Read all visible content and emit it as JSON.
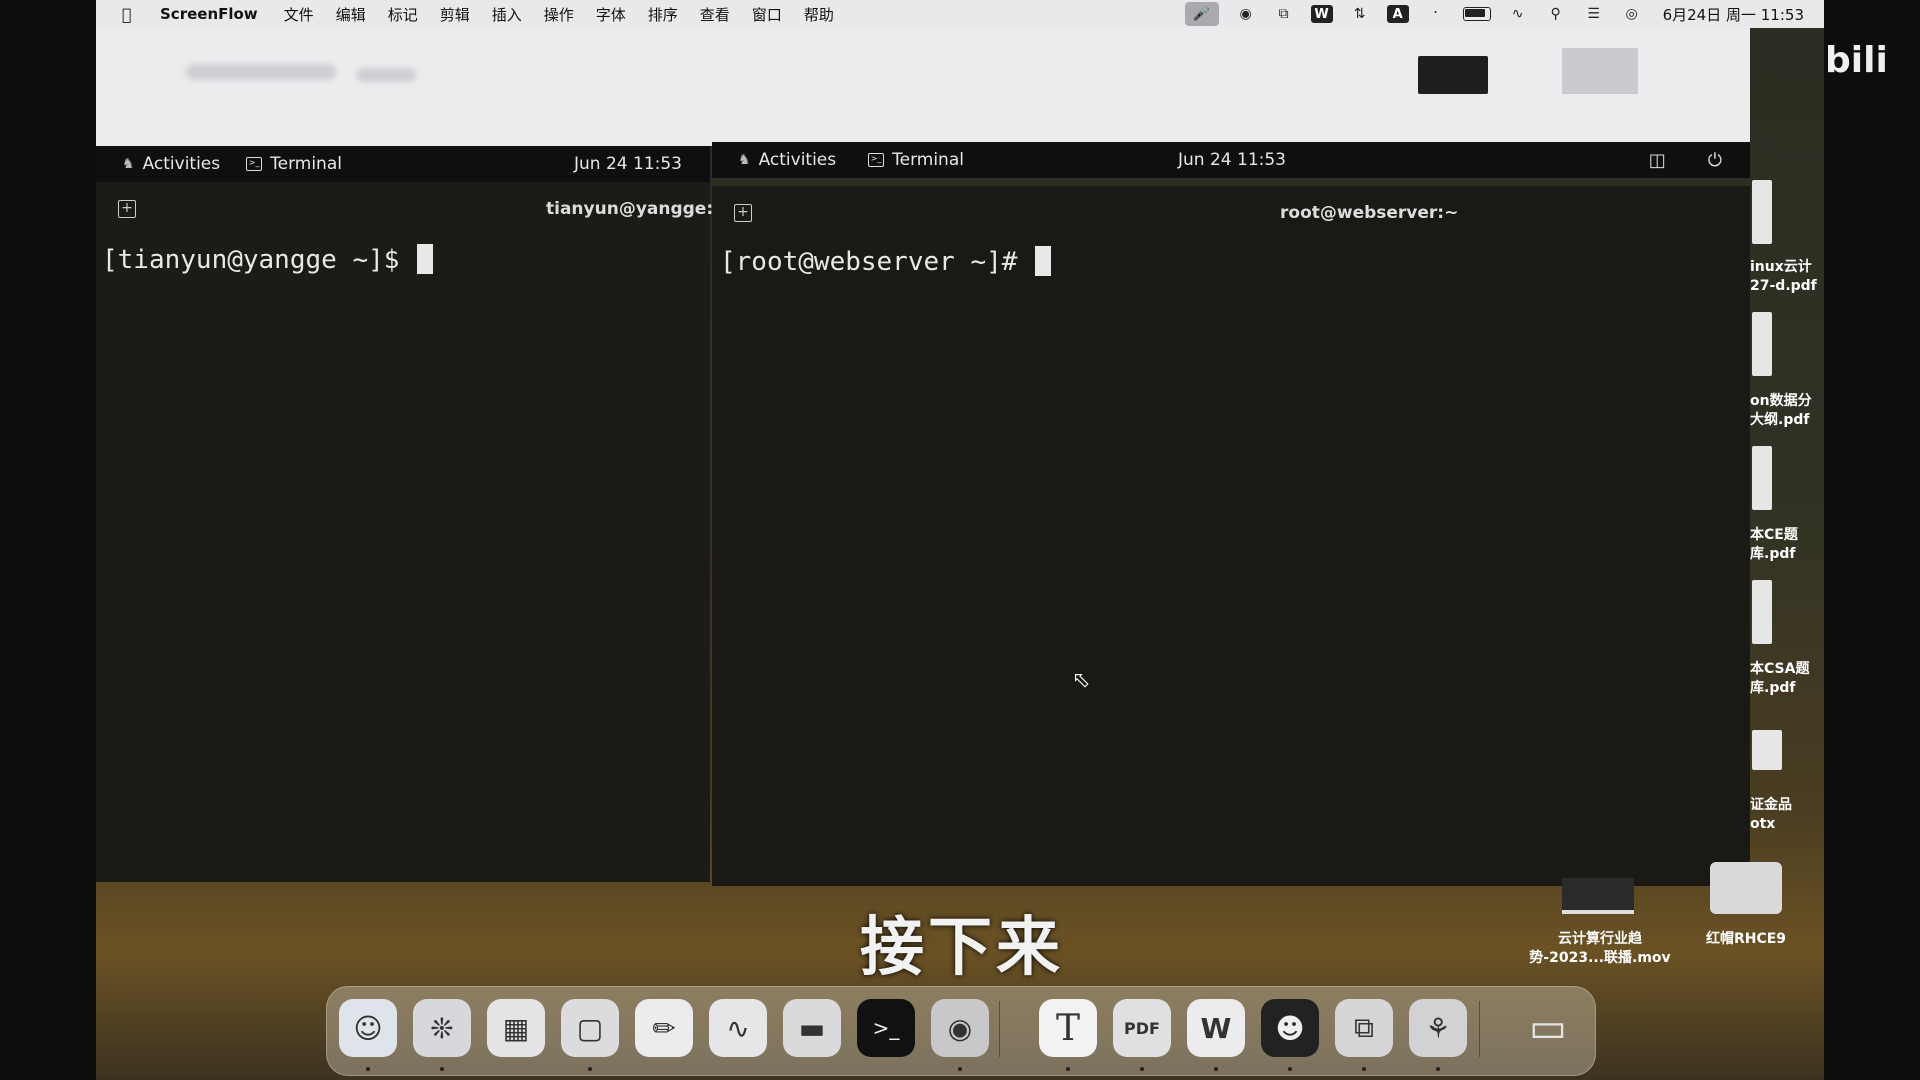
{
  "menubar": {
    "app_name": "ScreenFlow",
    "menus": [
      "文件",
      "编辑",
      "标记",
      "剪辑",
      "插入",
      "操作",
      "字体",
      "排序",
      "查看",
      "窗口",
      "帮助"
    ],
    "status_icons": [
      "microphone-icon",
      "camera-icon",
      "screen-icon",
      "wps-icon",
      "sync-icon",
      "input-method-icon",
      "bluetooth-icon",
      "battery-icon",
      "wifi-icon",
      "spotlight-icon",
      "control-center-icon",
      "siri-icon"
    ],
    "input_method_label": "A",
    "clock": "6月24日 周一  11:53"
  },
  "left_vm": {
    "activities": "Activities",
    "terminal_label": "Terminal",
    "date": "Jun 24  11:53",
    "window_title": "tianyun@yangge:~",
    "prompt": "[tianyun@yangge ~]$ "
  },
  "right_vm": {
    "activities": "Activities",
    "terminal_label": "Terminal",
    "date": "Jun 24  11:53",
    "window_title": "root@webserver:~",
    "prompt": "[root@webserver ~]# "
  },
  "desktop_files": [
    {
      "label": "inux云计\n27-d.pdf"
    },
    {
      "label": "on数据分\n大纲.pdf"
    },
    {
      "label": "本CE题\n库.pdf"
    },
    {
      "label": "本CSA题\n库.pdf"
    },
    {
      "label": "证金品\notx"
    }
  ],
  "desktop_items": {
    "movie_label": "云计算行业趋\n势-2023...联播.mov",
    "folder_label": "红帽RHCE9"
  },
  "subtitle": "接下来",
  "dock": {
    "apps": [
      "finder-icon",
      "safari-icon",
      "launchpad-icon",
      "messages-icon",
      "notes-icon",
      "freeform-icon",
      "folder-icon",
      "terminal-icon",
      "screenflow-icon",
      "typora-icon",
      "pdf-icon",
      "wps-icon",
      "chatbot-icon",
      "vmware-icon",
      "game-icon",
      "trash-icon"
    ],
    "pdf_label": "PDF",
    "typora_label": "T"
  }
}
